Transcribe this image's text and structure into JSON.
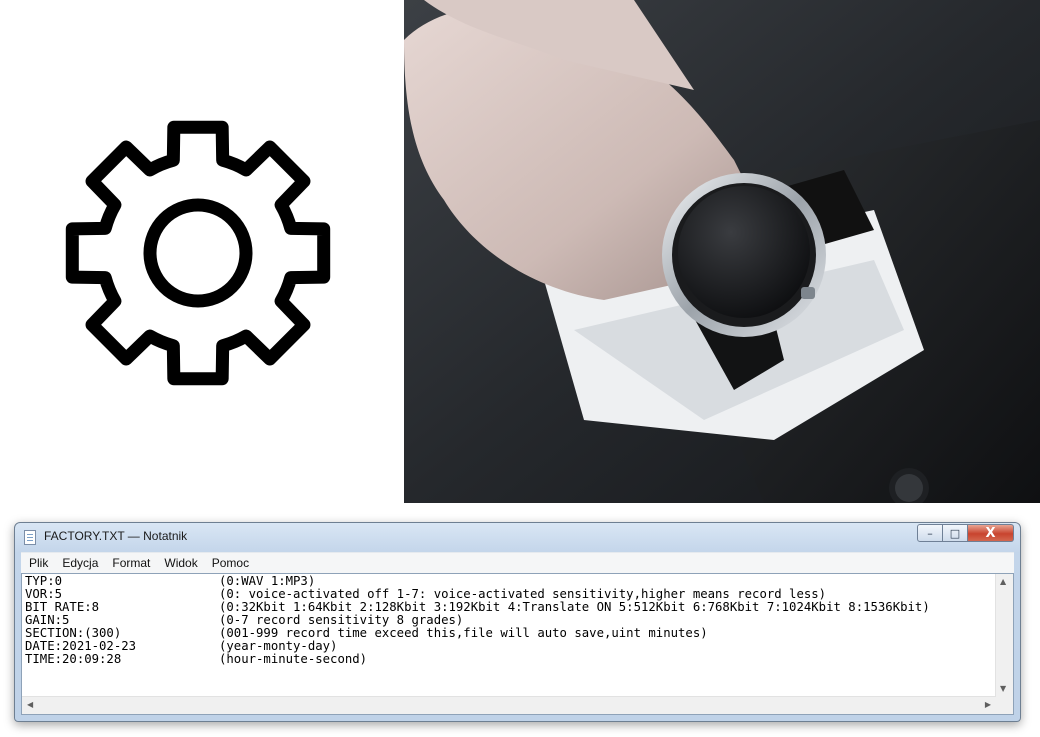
{
  "window": {
    "title": "FACTORY.TXT — Notatnik",
    "buttons": {
      "minimize": "–",
      "maximize": "□",
      "close": "X"
    }
  },
  "menu": [
    "Plik",
    "Edycja",
    "Format",
    "Widok",
    "Pomoc"
  ],
  "document_lines": [
    {
      "key": "TYP:0",
      "value": "(0:WAV 1:MP3)"
    },
    {
      "key": "VOR:5",
      "value": "(0: voice-activated off 1-7: voice-activated sensitivity,higher means record less)"
    },
    {
      "key": "BIT RATE:8",
      "value": "(0:32Kbit 1:64Kbit 2:128Kbit 3:192Kbit 4:Translate ON 5:512Kbit 6:768Kbit 7:1024Kbit 8:1536Kbit)"
    },
    {
      "key": "GAIN:5",
      "value": "(0-7 record sensitivity 8 grades)"
    },
    {
      "key": "SECTION:(300)",
      "value": "(001-999 record time exceed this,file will auto save,uint minutes)"
    },
    {
      "key": "DATE:2021-02-23",
      "value": "(year-monty-day)"
    },
    {
      "key": "TIME:20:09:28",
      "value": "(hour-minute-second)"
    }
  ],
  "icons": {
    "settings": "gear-icon",
    "file": "notepad-file-icon"
  },
  "colors": {
    "gear_stroke": "#000000",
    "close_button": "#c8442e",
    "window_frame": "#c3d5ea"
  }
}
